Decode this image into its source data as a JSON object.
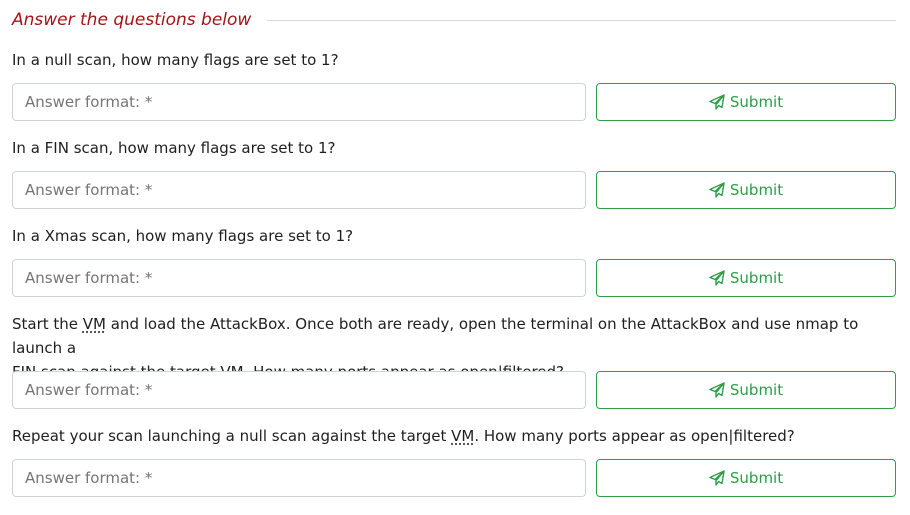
{
  "section": {
    "title": "Answer the questions below"
  },
  "questions": [
    {
      "text": "In a null scan, how many flags are set to 1?",
      "placeholder": "Answer format: *",
      "submit_label": "Submit"
    },
    {
      "text": "In a FIN scan, how many flags are set to 1?",
      "placeholder": "Answer format: *",
      "submit_label": "Submit"
    },
    {
      "text": "In a Xmas scan, how many flags are set to 1?",
      "placeholder": "Answer format: *",
      "submit_label": "Submit"
    },
    {
      "text_line1_before": "Start the ",
      "text_line1_vm": "VM",
      "text_line1_after": " and load the AttackBox. Once both are ready, open the terminal on the AttackBox and use nmap to launch a",
      "text_line2": "FIN scan against the target VM. How many ports appear as open|filtered?",
      "placeholder": "Answer format: *",
      "submit_label": "Submit"
    },
    {
      "text_before": "Repeat your scan launching a null scan against the target ",
      "text_vm": "VM",
      "text_after": ". How many ports appear as open|filtered?",
      "placeholder": "Answer format: *",
      "submit_label": "Submit"
    }
  ],
  "colors": {
    "title": "#a31515",
    "submit": "#2e9e44",
    "input_border": "#cfd4d9"
  },
  "icons": {
    "submit": "paper-plane-icon"
  }
}
